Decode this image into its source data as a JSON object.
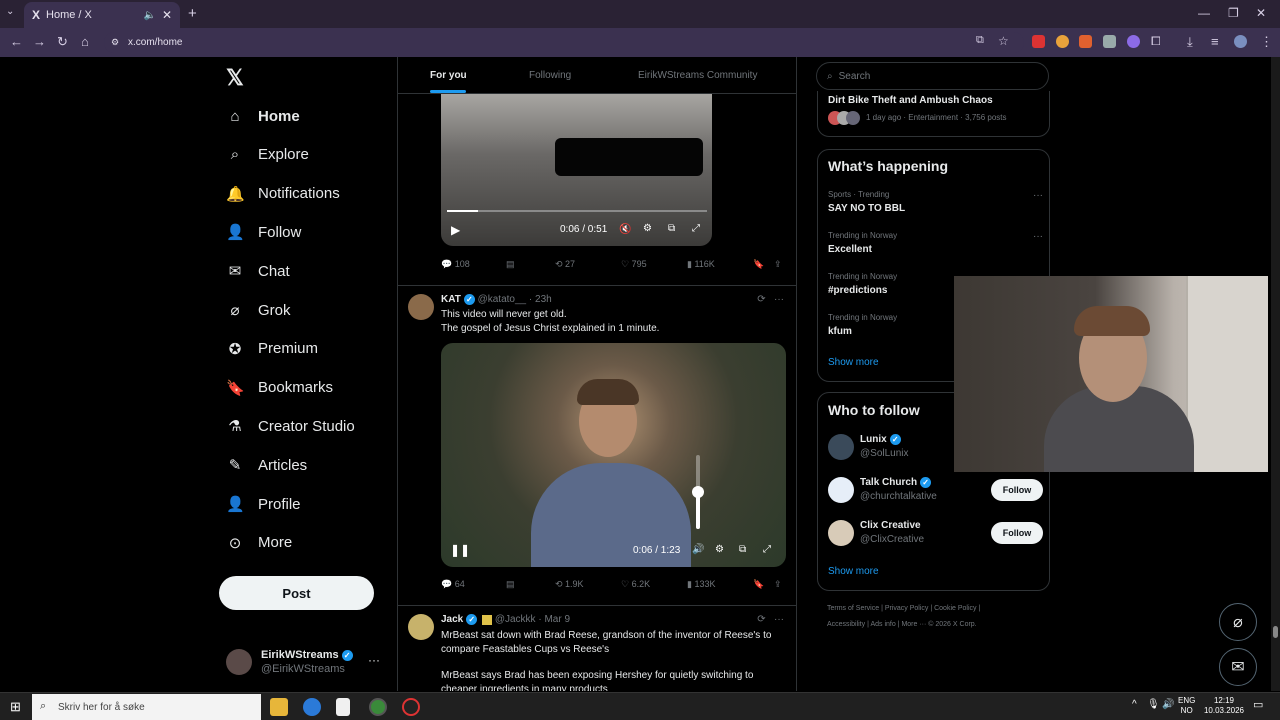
{
  "browser": {
    "tab_title": "Home / X",
    "tab_favicon": "X",
    "url": "x.com/home",
    "new_tab": "+",
    "minimize": "—",
    "restore": "❐",
    "close": "✕"
  },
  "nav": {
    "items": [
      {
        "label": "Home",
        "icon": "home-icon"
      },
      {
        "label": "Explore",
        "icon": "search-icon"
      },
      {
        "label": "Notifications",
        "icon": "bell-icon"
      },
      {
        "label": "Follow",
        "icon": "person-add-icon"
      },
      {
        "label": "Chat",
        "icon": "mail-icon"
      },
      {
        "label": "Grok",
        "icon": "grok-icon"
      },
      {
        "label": "Premium",
        "icon": "premium-icon"
      },
      {
        "label": "Bookmarks",
        "icon": "bookmark-icon"
      },
      {
        "label": "Creator Studio",
        "icon": "flask-icon"
      },
      {
        "label": "Articles",
        "icon": "article-icon"
      },
      {
        "label": "Profile",
        "icon": "person-icon"
      },
      {
        "label": "More",
        "icon": "more-circle-icon"
      }
    ],
    "post_label": "Post",
    "account": {
      "name": "EirikWStreams",
      "handle": "@EirikWStreams"
    }
  },
  "feed": {
    "tabs": [
      "For you",
      "Following",
      "EirikWStreams Community"
    ],
    "video1": {
      "time": "0:06 / 0:51",
      "progress": 0.12
    },
    "tweet1_actions": {
      "replies": "108",
      "reposts": "27",
      "likes": "795",
      "views": "116K"
    },
    "tweet2": {
      "name": "KAT",
      "handle": "@katato__",
      "time": "23h",
      "line1": "This video will never get old.",
      "line2": "The gospel of Jesus Christ explained in 1 minute.",
      "video_time": "0:06 / 1:23",
      "volume": 0.5,
      "replies": "64",
      "reposts": "1.9K",
      "likes": "6.2K",
      "views": "133K"
    },
    "tweet3": {
      "name": "Jack",
      "handle": "@Jackkk",
      "time": "Mar 9",
      "line1": "MrBeast sat down with Brad Reese, grandson of the inventor of Reese's to compare Feastables Cups vs Reese's",
      "line2": "MrBeast says Brad has been exposing Hershey for quietly switching to cheaper ingredients in many products"
    }
  },
  "right": {
    "search_placeholder": "Search",
    "top_story": {
      "title": "Dirt Bike Theft and Ambush Chaos",
      "meta": "1 day ago · Entertainment · 3,756 posts"
    },
    "happening_title": "What’s happening",
    "trends": [
      {
        "category": "Sports · Trending",
        "name": "SAY NO TO BBL"
      },
      {
        "category": "Trending in Norway",
        "name": "Excellent"
      },
      {
        "category": "Trending in Norway",
        "name": "#predictions"
      },
      {
        "category": "Trending in Norway",
        "name": "kfum"
      }
    ],
    "show_more": "Show more",
    "who_to_follow_title": "Who to follow",
    "suggestions": [
      {
        "name": "Lunix",
        "handle": "@SolLunix"
      },
      {
        "name": "Talk Church",
        "handle": "@churchtalkative",
        "button": "Follow"
      },
      {
        "name": "Clix Creative",
        "handle": "@ClixCreative",
        "button": "Follow"
      }
    ],
    "footer_line1": "Terms of Service  |  Privacy Policy  |  Cookie Policy  |",
    "footer_line2": "Accessibility  |  Ads info  |  More ···  © 2026 X Corp."
  },
  "taskbar": {
    "search_placeholder": "Skriv her for å søke",
    "lang1": "ENG",
    "lang2": "NO",
    "time": "12:19",
    "date": "10.03.2026"
  },
  "colors": {
    "accent": "#1d9bf0",
    "background": "#000000",
    "browser_chrome": "#3b3150"
  }
}
